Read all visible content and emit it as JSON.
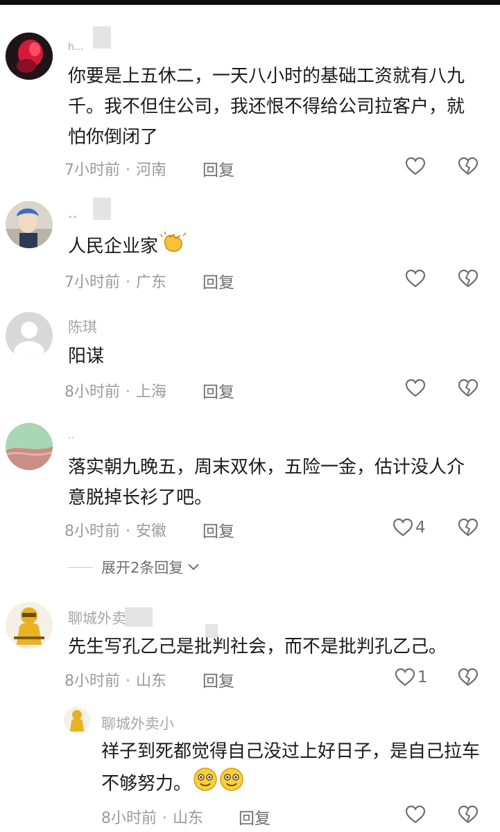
{
  "comments": [
    {
      "username": "h...",
      "text": "你要是上五休二，一天八小时的基础工资就有八九千。我不但住公司，我还恨不得给公司拉客户，就怕你倒闭了",
      "time": "7小时前",
      "location": "河南",
      "reply": "回复",
      "likes": ""
    },
    {
      "username": "..",
      "text": "人民企业家",
      "time": "7小时前",
      "location": "广东",
      "reply": "回复",
      "likes": ""
    },
    {
      "username": "陈琪",
      "text": "阳谋",
      "time": "8小时前",
      "location": "上海",
      "reply": "回复",
      "likes": ""
    },
    {
      "username": "..",
      "text": "落实朝九晚五，周末双休，五险一金，估计没人介意脱掉长衫了吧。",
      "time": "8小时前",
      "location": "安徽",
      "reply": "回复",
      "likes": "4",
      "expand": "展开2条回复"
    },
    {
      "username": "聊城外卖",
      "text": "先生写孔乙己是批判社会，而不是批判孔乙己。",
      "time": "8小时前",
      "location": "山东",
      "reply": "回复",
      "likes": "1"
    },
    {
      "username": "聊城外卖小",
      "text": "祥子到死都觉得自己没过上好日子，是自己拉车不够努力。",
      "time": "8小时前",
      "location": "山东",
      "reply": "回复",
      "likes": ""
    }
  ],
  "colors": {
    "meta": "#9a9a9a",
    "text": "#1a1a1a",
    "icon": "#6e6e6e"
  },
  "icons": [
    "heart-icon",
    "broken-heart-icon",
    "chevron-down-icon",
    "clapping-hands-icon",
    "smiling-face-icon"
  ]
}
